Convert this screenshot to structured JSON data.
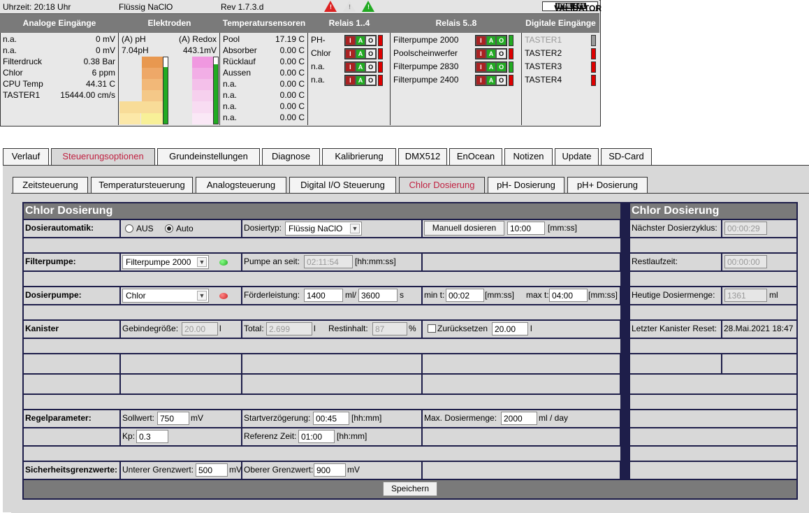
{
  "topbar": {
    "time": "Uhrzeit: 20:18 Uhr",
    "mode": "Flüssig NaClO",
    "rev": "Rev 1.7.3.d",
    "validator": "HTML 4.01",
    "validator_brand": "VALIDATOR"
  },
  "status_header": {
    "analog": "Analoge Eingänge",
    "elektroden": "Elektroden",
    "temp": "Temperatursensoren",
    "relais14": "Relais 1..4",
    "relais58": "Relais 5..8",
    "digital": "Digitale Eingänge"
  },
  "analog": [
    {
      "label": "n.a.",
      "value": "0 mV"
    },
    {
      "label": "n.a.",
      "value": "0 mV"
    },
    {
      "label": "Filterdruck",
      "value": "0.38 Bar"
    },
    {
      "label": "Chlor",
      "value": "6 ppm"
    },
    {
      "label": "CPU Temp",
      "value": "44.31 C"
    },
    {
      "label": "TASTER1",
      "value": "15444.00 cm/s"
    }
  ],
  "elektroden": {
    "ph_label": "(A) pH",
    "ph_value": "7.04pH",
    "redox_label": "(A) Redox",
    "redox_value": "443.1mV"
  },
  "temps": [
    {
      "label": "Pool",
      "value": "17.19 C"
    },
    {
      "label": "Absorber",
      "value": "0.00 C"
    },
    {
      "label": "Rücklauf",
      "value": "0.00 C"
    },
    {
      "label": "Aussen",
      "value": "0.00 C"
    },
    {
      "label": "n.a.",
      "value": "0.00 C"
    },
    {
      "label": "n.a.",
      "value": "0.00 C"
    },
    {
      "label": "n.a.",
      "value": "0.00 C"
    },
    {
      "label": "n.a.",
      "value": "0.00 C"
    }
  ],
  "relais14": [
    {
      "label": "PH-"
    },
    {
      "label": "Chlor"
    },
    {
      "label": "n.a."
    },
    {
      "label": "n.a."
    }
  ],
  "relais58": [
    {
      "label": "Filterpumpe 2000"
    },
    {
      "label": "Poolscheinwerfer"
    },
    {
      "label": "Filterpumpe 2830"
    },
    {
      "label": "Filterpumpe 2400"
    }
  ],
  "iao": {
    "i": "I",
    "a": "A",
    "o": "O"
  },
  "digital": [
    {
      "label": "TASTER1"
    },
    {
      "label": "TASTER2"
    },
    {
      "label": "TASTER3"
    },
    {
      "label": "TASTER4"
    }
  ],
  "main_tabs": [
    "Verlauf",
    "Steuerungsoptionen",
    "Grundeinstellungen",
    "Diagnose",
    "Kalibrierung",
    "DMX512",
    "EnOcean",
    "Notizen",
    "Update",
    "SD-Card"
  ],
  "sub_tabs": [
    "Zeitsteuerung",
    "Temperatursteuerung",
    "Analogsteuerung",
    "Digital I/O Steuerung",
    "Chlor Dosierung",
    "pH- Dosierung",
    "pH+ Dosierung"
  ],
  "panel": {
    "title_left": "Chlor Dosierung",
    "title_right": "Chlor Dosierung",
    "dosierautomatik": "Dosierautomatik:",
    "aus": "AUS",
    "auto": "Auto",
    "dosiertyp": "Dosiertyp:",
    "dosiertyp_value": "Flüssig NaClO",
    "manuell_btn": "Manuell dosieren",
    "manuell_value": "10:00",
    "mmss": "[mm:ss]",
    "naechster": "Nächster Dosierzyklus:",
    "naechster_value": "00:00:29",
    "filterpumpe": "Filterpumpe:",
    "filterpumpe_value": "Filterpumpe 2000",
    "pumpe_seit": "Pumpe an seit:",
    "pumpe_seit_value": "02:11:54",
    "hhmmss": "[hh:mm:ss]",
    "restlauf": "Restlaufzeit:",
    "restlauf_value": "00:00:00",
    "dosierpumpe": "Dosierpumpe:",
    "dosierpumpe_value": "Chlor",
    "foerder": "Förderleistung:",
    "foerder_ml": "1400",
    "ml_sep": "ml/",
    "foerder_s": "3600",
    "s": "s",
    "min_t": "min t:",
    "min_t_value": "00:02",
    "max_t": "max t:",
    "max_t_value": "04:00",
    "heutige": "Heutige Dosiermenge:",
    "heutige_value": "1361",
    "ml": "ml",
    "kanister": "Kanister",
    "gebinde": "Gebindegröße:",
    "gebinde_value": "20.00",
    "l": "l",
    "total": "Total:",
    "total_value": "2.699",
    "restinhalt": "Restinhalt:",
    "restinhalt_value": "87",
    "pct": "%",
    "zurueck": "Zurücksetzen",
    "zurueck_value": "20.00",
    "letzter": "Letzter Kanister Reset:",
    "letzter_value": "28.Mai.2021 18:47",
    "regel": "Regelparameter:",
    "sollwert": "Sollwert:",
    "sollwert_value": "750",
    "mv": "mV",
    "startverz": "Startverzögerung:",
    "startverz_value": "00:45",
    "hhmm": "[hh:mm]",
    "maxdosier": "Max. Dosiermenge:",
    "maxdosier_value": "2000",
    "mlday": "ml / day",
    "kp": "Kp:",
    "kp_value": "0.3",
    "referenz": "Referenz Zeit:",
    "referenz_value": "01:00",
    "sicher": "Sicherheitsgrenzwerte:",
    "unterer": "Unterer Grenzwert:",
    "unterer_value": "500",
    "oberer": "Oberer Grenzwert:",
    "oberer_value": "900",
    "save": "Speichern"
  }
}
